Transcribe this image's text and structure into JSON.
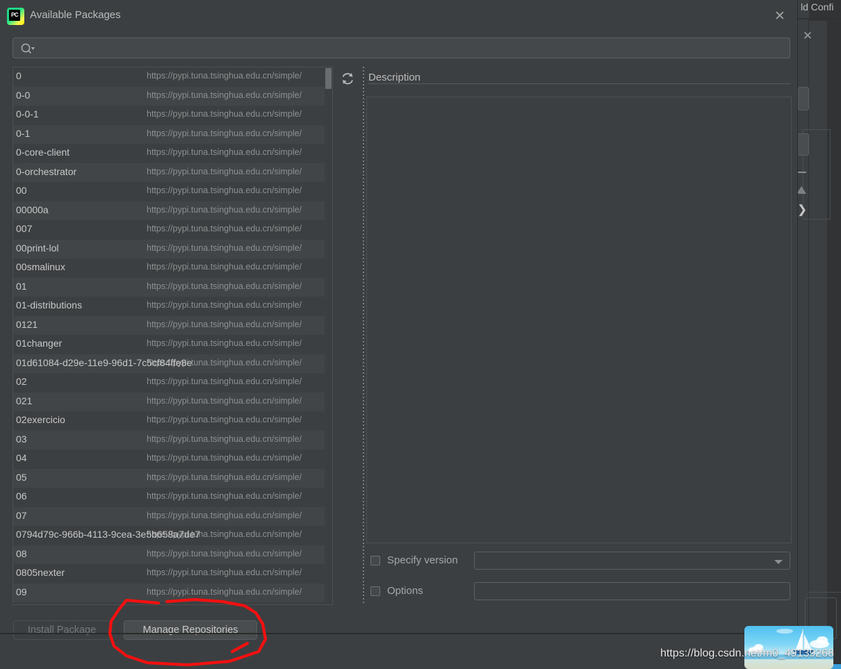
{
  "background": {
    "partial_window_title": "ld Confi",
    "close_icon": "close-icon"
  },
  "dialog": {
    "title": "Available Packages",
    "app_icon_text": "PC",
    "close_label": "✕"
  },
  "search": {
    "value": "",
    "placeholder": "",
    "icon": "search-icon"
  },
  "list": {
    "refresh_icon": "refresh-icon",
    "rows": [
      {
        "name": "0",
        "url": "https://pypi.tuna.tsinghua.edu.cn/simple/"
      },
      {
        "name": "0-0",
        "url": "https://pypi.tuna.tsinghua.edu.cn/simple/"
      },
      {
        "name": "0-0-1",
        "url": "https://pypi.tuna.tsinghua.edu.cn/simple/"
      },
      {
        "name": "0-1",
        "url": "https://pypi.tuna.tsinghua.edu.cn/simple/"
      },
      {
        "name": "0-core-client",
        "url": "https://pypi.tuna.tsinghua.edu.cn/simple/"
      },
      {
        "name": "0-orchestrator",
        "url": "https://pypi.tuna.tsinghua.edu.cn/simple/"
      },
      {
        "name": "00",
        "url": "https://pypi.tuna.tsinghua.edu.cn/simple/"
      },
      {
        "name": "00000a",
        "url": "https://pypi.tuna.tsinghua.edu.cn/simple/"
      },
      {
        "name": "007",
        "url": "https://pypi.tuna.tsinghua.edu.cn/simple/"
      },
      {
        "name": "00print-lol",
        "url": "https://pypi.tuna.tsinghua.edu.cn/simple/"
      },
      {
        "name": "00smalinux",
        "url": "https://pypi.tuna.tsinghua.edu.cn/simple/"
      },
      {
        "name": "01",
        "url": "https://pypi.tuna.tsinghua.edu.cn/simple/"
      },
      {
        "name": "01-distributions",
        "url": "https://pypi.tuna.tsinghua.edu.cn/simple/"
      },
      {
        "name": "0121",
        "url": "https://pypi.tuna.tsinghua.edu.cn/simple/"
      },
      {
        "name": "01changer",
        "url": "https://pypi.tuna.tsinghua.edu.cn/simple/"
      },
      {
        "name": "01d61084-d29e-11e9-96d1-7c5cf84ffe8e",
        "url": "https://pypi.tuna.tsinghua.edu.cn/simple/"
      },
      {
        "name": "02",
        "url": "https://pypi.tuna.tsinghua.edu.cn/simple/"
      },
      {
        "name": "021",
        "url": "https://pypi.tuna.tsinghua.edu.cn/simple/"
      },
      {
        "name": "02exercicio",
        "url": "https://pypi.tuna.tsinghua.edu.cn/simple/"
      },
      {
        "name": "03",
        "url": "https://pypi.tuna.tsinghua.edu.cn/simple/"
      },
      {
        "name": "04",
        "url": "https://pypi.tuna.tsinghua.edu.cn/simple/"
      },
      {
        "name": "05",
        "url": "https://pypi.tuna.tsinghua.edu.cn/simple/"
      },
      {
        "name": "06",
        "url": "https://pypi.tuna.tsinghua.edu.cn/simple/"
      },
      {
        "name": "07",
        "url": "https://pypi.tuna.tsinghua.edu.cn/simple/"
      },
      {
        "name": "0794d79c-966b-4113-9cea-3e5b658a7de7",
        "url": "https://pypi.tuna.tsinghua.edu.cn/simple/"
      },
      {
        "name": "08",
        "url": "https://pypi.tuna.tsinghua.edu.cn/simple/"
      },
      {
        "name": "0805nexter",
        "url": "https://pypi.tuna.tsinghua.edu.cn/simple/"
      },
      {
        "name": "09",
        "url": "https://pypi.tuna.tsinghua.edu.cn/simple/"
      }
    ]
  },
  "description": {
    "label": "Description",
    "content": ""
  },
  "options": {
    "specify_version_label": "Specify version",
    "specify_version_checked": false,
    "version_value": "",
    "options_label": "Options",
    "options_checked": false,
    "options_value": ""
  },
  "buttons": {
    "install": "Install Package",
    "install_enabled": false,
    "manage": "Manage Repositories",
    "manage_enabled": true
  },
  "annotation": {
    "color": "#f41010",
    "target": "Manage Repositories"
  },
  "watermark": {
    "text": "https://blog.csdn.net/m0_49139268"
  }
}
